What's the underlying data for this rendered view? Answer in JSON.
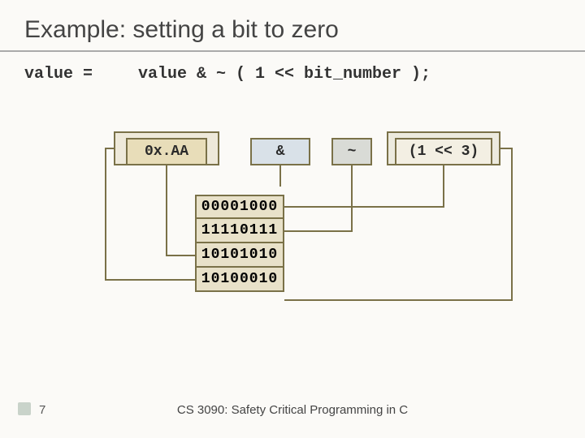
{
  "title": "Example: setting a bit to zero",
  "expression": {
    "lhs": "value =",
    "rhs": "value & ~ ( 1 << bit_number );"
  },
  "boxes": {
    "hex": "0x.AA",
    "and": "&",
    "not": "~",
    "shift": "(1 << 3)"
  },
  "binary_rows": [
    "00001000",
    "11110111",
    "10101010",
    "10100010"
  ],
  "footer": {
    "page": "7",
    "course": "CS 3090: Safety Critical Programming in C"
  },
  "colors": {
    "line": "#7a7148"
  }
}
